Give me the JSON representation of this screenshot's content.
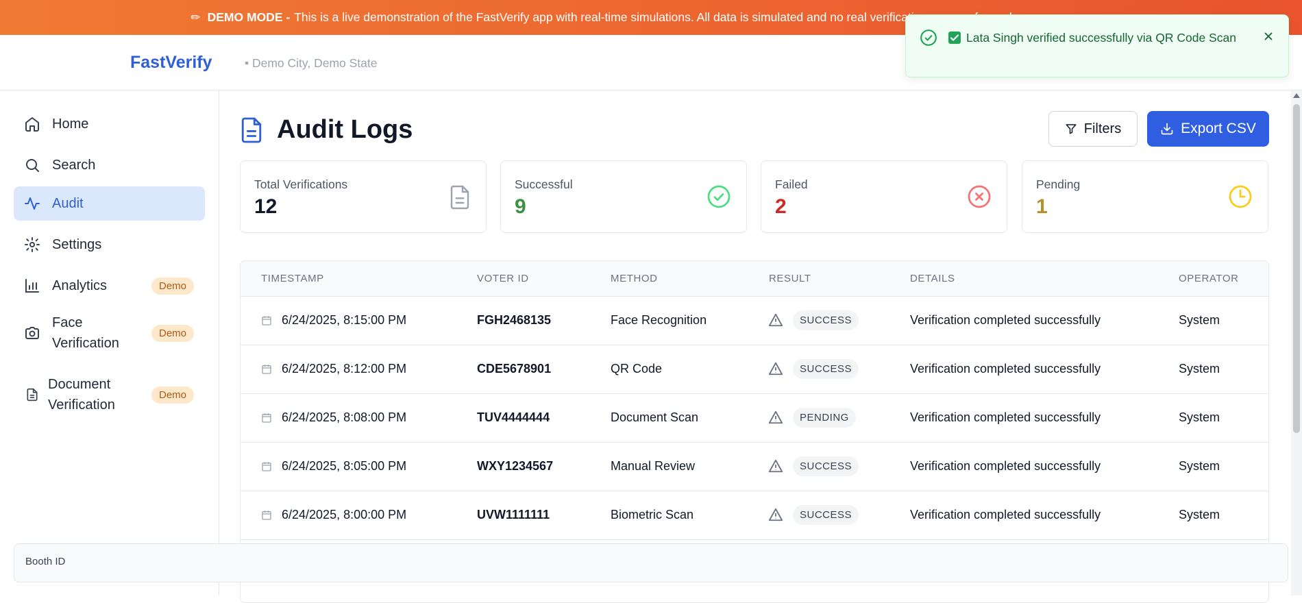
{
  "banner": {
    "label": "DEMO MODE -",
    "text": "This is a live demonstration of the FastVerify app with real-time simulations. All data is simulated and no real verifications are performed."
  },
  "header": {
    "brand": "FastVerify",
    "location": "• Demo City, Demo State"
  },
  "sidebar": {
    "items": [
      {
        "label": "Home",
        "icon": "home-icon"
      },
      {
        "label": "Search",
        "icon": "search-icon"
      },
      {
        "label": "Audit",
        "icon": "activity-icon"
      },
      {
        "label": "Settings",
        "icon": "gear-icon"
      },
      {
        "label": "Analytics",
        "icon": "bar-chart-icon",
        "badge": "Demo"
      },
      {
        "label": "Face Verification",
        "icon": "camera-icon",
        "badge": "Demo"
      },
      {
        "label": "Document Verification",
        "icon": "file-icon",
        "badge": "Demo"
      }
    ],
    "booth_label": "Booth ID"
  },
  "page": {
    "title": "Audit Logs",
    "filters_label": "Filters",
    "export_label": "Export CSV"
  },
  "stats": [
    {
      "label": "Total Verifications",
      "value": "12",
      "color": "#111827"
    },
    {
      "label": "Successful",
      "value": "9",
      "color": "#3f9142"
    },
    {
      "label": "Failed",
      "value": "2",
      "color": "#c92a2a"
    },
    {
      "label": "Pending",
      "value": "1",
      "color": "#b7902a"
    }
  ],
  "table": {
    "columns": [
      "TIMESTAMP",
      "VOTER ID",
      "METHOD",
      "RESULT",
      "DETAILS",
      "OPERATOR"
    ],
    "rows": [
      {
        "timestamp": "6/24/2025, 8:15:00 PM",
        "voter_id": "FGH2468135",
        "method": "Face Recognition",
        "result": "SUCCESS",
        "details": "Verification completed successfully",
        "operator": "System"
      },
      {
        "timestamp": "6/24/2025, 8:12:00 PM",
        "voter_id": "CDE5678901",
        "method": "QR Code",
        "result": "SUCCESS",
        "details": "Verification completed successfully",
        "operator": "System"
      },
      {
        "timestamp": "6/24/2025, 8:08:00 PM",
        "voter_id": "TUV4444444",
        "method": "Document Scan",
        "result": "PENDING",
        "details": "Verification completed successfully",
        "operator": "System"
      },
      {
        "timestamp": "6/24/2025, 8:05:00 PM",
        "voter_id": "WXY1234567",
        "method": "Manual Review",
        "result": "SUCCESS",
        "details": "Verification completed successfully",
        "operator": "System"
      },
      {
        "timestamp": "6/24/2025, 8:00:00 PM",
        "voter_id": "UVW1111111",
        "method": "Biometric Scan",
        "result": "SUCCESS",
        "details": "Verification completed successfully",
        "operator": "System"
      }
    ]
  },
  "toast": {
    "message": "Lata Singh verified successfully via QR Code Scan"
  },
  "colors": {
    "accent": "#2f5fe0",
    "banner": "#ec6a30",
    "success": "#22a35a"
  }
}
